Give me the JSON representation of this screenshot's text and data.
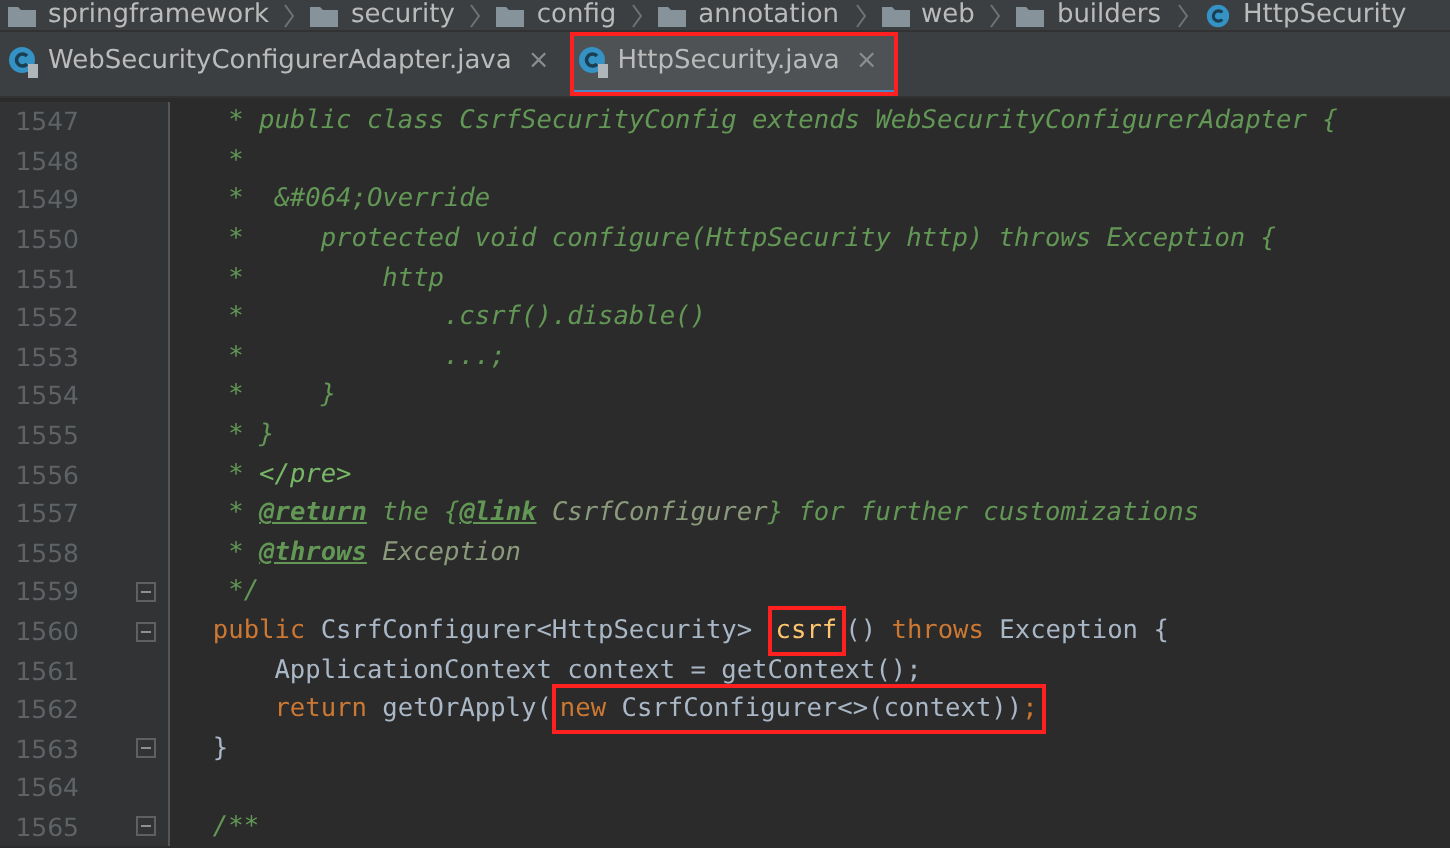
{
  "breadcrumb": [
    {
      "label": "springframework",
      "kind": "folder"
    },
    {
      "label": "security",
      "kind": "folder"
    },
    {
      "label": "config",
      "kind": "folder"
    },
    {
      "label": "annotation",
      "kind": "folder"
    },
    {
      "label": "web",
      "kind": "folder"
    },
    {
      "label": "builders",
      "kind": "folder"
    },
    {
      "label": "HttpSecurity",
      "kind": "class"
    }
  ],
  "tabs": [
    {
      "label": "WebSecurityConfigurerAdapter.java",
      "close": "×",
      "selected": false,
      "boxed": false
    },
    {
      "label": "HttpSecurity.java",
      "close": "×",
      "selected": true,
      "boxed": true
    }
  ],
  "lines": [
    {
      "number": "1547",
      "fold": false,
      "tokens": [
        {
          "text": "   * public class CsrfSecurityConfig extends WebSecurityConfigurerAdapter {",
          "kind": "comment",
          "boxed": false
        }
      ]
    },
    {
      "number": "1548",
      "fold": false,
      "tokens": [
        {
          "text": "   *",
          "kind": "comment",
          "boxed": false
        }
      ]
    },
    {
      "number": "1549",
      "fold": false,
      "tokens": [
        {
          "text": "   *  &#064;Override",
          "kind": "comment",
          "boxed": false
        }
      ]
    },
    {
      "number": "1550",
      "fold": false,
      "tokens": [
        {
          "text": "   *     protected void configure(HttpSecurity http) throws Exception {",
          "kind": "comment",
          "boxed": false
        }
      ]
    },
    {
      "number": "1551",
      "fold": false,
      "tokens": [
        {
          "text": "   *         http",
          "kind": "comment",
          "boxed": false
        }
      ]
    },
    {
      "number": "1552",
      "fold": false,
      "tokens": [
        {
          "text": "   *             .csrf().disable()",
          "kind": "comment",
          "boxed": false
        }
      ]
    },
    {
      "number": "1553",
      "fold": false,
      "tokens": [
        {
          "text": "   *             ...;",
          "kind": "comment",
          "boxed": false
        }
      ]
    },
    {
      "number": "1554",
      "fold": false,
      "tokens": [
        {
          "text": "   *     }",
          "kind": "comment",
          "boxed": false
        }
      ]
    },
    {
      "number": "1555",
      "fold": false,
      "tokens": [
        {
          "text": "   * }",
          "kind": "comment",
          "boxed": false
        }
      ]
    },
    {
      "number": "1556",
      "fold": false,
      "tokens": [
        {
          "text": "   * ",
          "kind": "comment",
          "boxed": false
        },
        {
          "text": "</pre>",
          "kind": "tag",
          "boxed": false
        }
      ]
    },
    {
      "number": "1557",
      "fold": false,
      "tokens": [
        {
          "text": "   * ",
          "kind": "comment",
          "boxed": false
        },
        {
          "text": "@return",
          "kind": "doctag",
          "boxed": false
        },
        {
          "text": " the {",
          "kind": "comment",
          "boxed": false
        },
        {
          "text": "@link",
          "kind": "doctag",
          "boxed": false
        },
        {
          "text": " CsrfConfigurer",
          "kind": "docref",
          "boxed": false
        },
        {
          "text": "} for further customizations",
          "kind": "comment",
          "boxed": false
        }
      ]
    },
    {
      "number": "1558",
      "fold": false,
      "tokens": [
        {
          "text": "   * ",
          "kind": "comment",
          "boxed": false
        },
        {
          "text": "@throws",
          "kind": "doctag",
          "boxed": false
        },
        {
          "text": " Exception",
          "kind": "docref",
          "boxed": false
        }
      ]
    },
    {
      "number": "1559",
      "fold": true,
      "tokens": [
        {
          "text": "   */",
          "kind": "comment",
          "boxed": false
        }
      ]
    },
    {
      "number": "1560",
      "fold": true,
      "tokens": [
        {
          "text": "  public ",
          "kind": "keyword",
          "boxed": false
        },
        {
          "text": "CsrfConfigurer<HttpSecurity> ",
          "kind": "plain",
          "boxed": false
        },
        {
          "text": "csrf",
          "kind": "method",
          "boxed": true
        },
        {
          "text": "() ",
          "kind": "plain",
          "boxed": false
        },
        {
          "text": "throws ",
          "kind": "keyword",
          "boxed": false
        },
        {
          "text": "Exception {",
          "kind": "plain",
          "boxed": false
        }
      ]
    },
    {
      "number": "1561",
      "fold": false,
      "tokens": [
        {
          "text": "      ApplicationContext context = getContext();",
          "kind": "plain",
          "boxed": false
        }
      ]
    },
    {
      "number": "1562",
      "fold": false,
      "tokens": [
        {
          "text": "      return ",
          "kind": "keyword",
          "boxed": false
        },
        {
          "text": "getOrApply(",
          "kind": "plain",
          "boxed": false
        },
        {
          "text": "new ",
          "kind": "keyword",
          "boxed": true
        },
        {
          "text": "CsrfConfigurer<>(context))",
          "kind": "plain",
          "boxed": true
        },
        {
          "text": ";",
          "kind": "keyword",
          "boxed": true
        }
      ]
    },
    {
      "number": "1563",
      "fold": true,
      "tokens": [
        {
          "text": "  }",
          "kind": "plain",
          "boxed": false
        }
      ]
    },
    {
      "number": "1564",
      "fold": false
    },
    {
      "number": "1565",
      "fold": true,
      "tokens": [
        {
          "text": "  /**",
          "kind": "comment",
          "boxed": false
        }
      ]
    }
  ]
}
